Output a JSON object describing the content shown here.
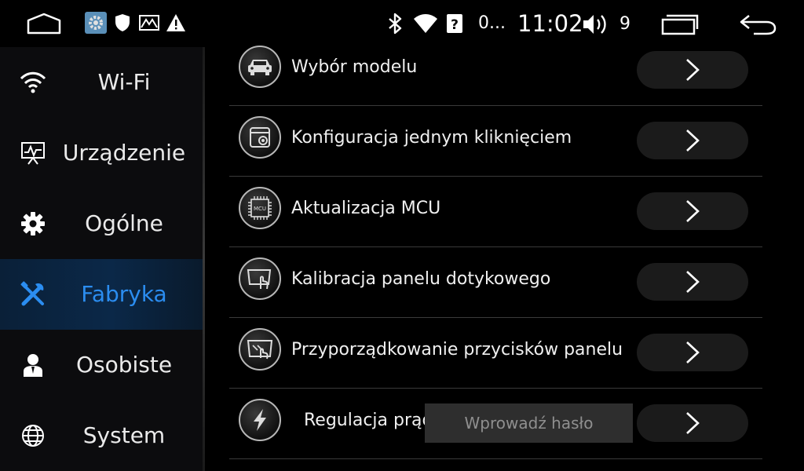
{
  "statusbar": {
    "battery_text": "0...",
    "clock": "11:02",
    "volume_level": "9",
    "icons": [
      "home-icon",
      "settings-notification-icon",
      "shield-icon",
      "mail-icon",
      "warning-icon",
      "bluetooth-icon",
      "wifi-icon",
      "unknown-network-icon",
      "volume-icon",
      "recents-icon",
      "back-icon"
    ]
  },
  "sidebar": {
    "items": [
      {
        "label": "Wi-Fi",
        "icon": "wifi-icon"
      },
      {
        "label": "Urządzenie",
        "icon": "device-monitor-icon"
      },
      {
        "label": "Ogólne",
        "icon": "gear-icon"
      },
      {
        "label": "Fabryka",
        "icon": "tools-icon",
        "active": true
      },
      {
        "label": "Osobiste",
        "icon": "person-icon"
      },
      {
        "label": "System",
        "icon": "globe-icon"
      }
    ]
  },
  "rows": [
    {
      "label": "Wybór modelu",
      "icon": "car-icon"
    },
    {
      "label": "Konfiguracja jednym kliknięciem",
      "icon": "one-click-config-icon"
    },
    {
      "label": "Aktualizacja MCU",
      "icon": "mcu-chip-icon",
      "icon_text": "MCU"
    },
    {
      "label": "Kalibracja panelu dotykowego",
      "icon": "touch-calibration-icon"
    },
    {
      "label": "Przyporządkowanie przycisków panelu",
      "icon": "panel-buttons-icon"
    },
    {
      "label": "Regulacja prąd",
      "icon": "lightning-icon"
    }
  ],
  "password_prompt": {
    "placeholder": "Wprowadź hasło"
  },
  "colors": {
    "accent": "#2b8df0",
    "background": "#000000",
    "divider": "#3a3a3a"
  }
}
